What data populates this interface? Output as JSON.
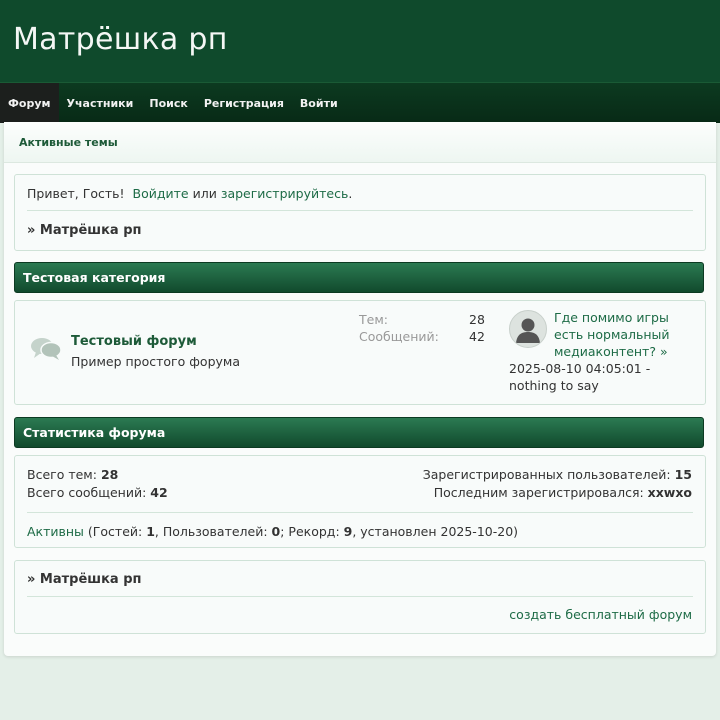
{
  "header": {
    "title": "Матрёшка рп"
  },
  "nav": {
    "items": [
      {
        "label": "Форум",
        "active": true
      },
      {
        "label": "Участники"
      },
      {
        "label": "Поиск"
      },
      {
        "label": "Регистрация"
      },
      {
        "label": "Войти"
      }
    ]
  },
  "subnav": {
    "active_topics": "Активные темы"
  },
  "welcome": {
    "greeting": "Привет, Гость!",
    "login_link": "Войдите",
    "or": "или",
    "register_link": "зарегистрируйтесь",
    "period": ".",
    "breadcrumb": "» Матрёшка рп"
  },
  "category": {
    "title": "Тестовая категория",
    "forum": {
      "name": "Тестовый форум",
      "description": "Пример простого форума",
      "topics_label": "Тем:",
      "topics_value": "28",
      "posts_label": "Сообщений:",
      "posts_value": "42",
      "last_post_title": "Где помимо игры есть нормальный медиаконтент? »",
      "last_post_meta": "2025-08-10 04:05:01 - nothing to say"
    }
  },
  "stats": {
    "title": "Статистика форума",
    "total_topics_label": "Всего тем:",
    "total_topics_value": "28",
    "total_posts_label": "Всего сообщений:",
    "total_posts_value": "42",
    "registered_label": "Зарегистрированных пользователей:",
    "registered_value": "15",
    "last_registered_label": "Последним зарегистрировался:",
    "last_registered_value": "xxwxo",
    "online_link": "Активны",
    "online_open": " (Гостей: ",
    "guests": "1",
    "users_label": ", Пользователей: ",
    "users": "0",
    "record_label": "; Рекорд: ",
    "record": "9",
    "record_set": ", установлен 2025-10-20)"
  },
  "footer": {
    "breadcrumb": "» Матрёшка рп",
    "create_link": "создать бесплатный форум"
  },
  "colors": {
    "header_bg": "#0f4a2c",
    "nav_bg": "#082a16",
    "accent": "#1d6b46",
    "page_bg": "#e4efe8"
  }
}
